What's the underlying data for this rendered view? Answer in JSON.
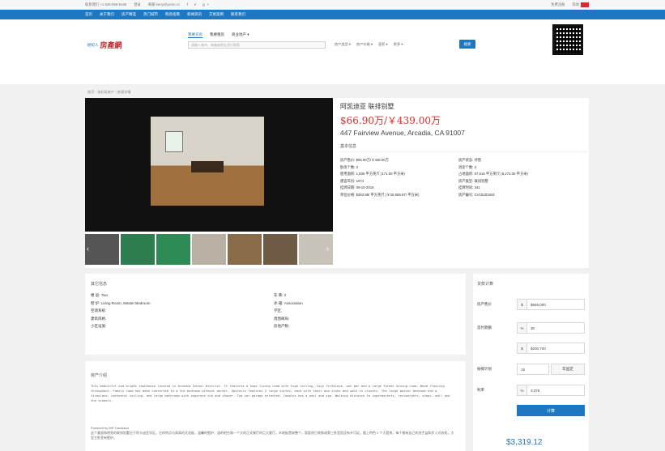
{
  "topbar": {
    "phone": "联系我们 +1 626-559-9168",
    "login": "登录",
    "email": "邮箱 kerry@yiviru.cc",
    "social": "f ✔ g+",
    "register": "免费注册",
    "lang": "简体"
  },
  "nav": [
    "首页",
    "关于我们",
    "房产精选",
    "热门城市",
    "购房指南",
    "新闻资讯",
    "交易案例",
    "联系我们"
  ],
  "logo": {
    "small": "經紀人",
    "mark": "房產網"
  },
  "search": {
    "tabs": [
      "我要买房",
      "我要租房",
      "商业地产 ▾"
    ],
    "placeholder": "请输入城市、邮编或地址进行搜索",
    "filters": [
      "房产类型 ▾",
      "房产价格 ▾",
      "面积 ▾",
      "更多 ▾"
    ],
    "button": "搜索"
  },
  "breadcrumb": "首页 › 洛杉矶房产 › 房源详情",
  "listing": {
    "title": "阿凯迪亚 联排别墅",
    "price": "$66.90万/￥439.00万",
    "address": "447 Fairview Avenue, Arcadia, CA 91007",
    "basic_title": "基本信息",
    "details": [
      "房产售价: $66.90万/￥439.00万",
      "房产状态: 待售",
      "卧房个数: 3",
      "浴室个数: 3",
      "使用面积: 1,838 平方英尺 (171.00 平方米)",
      "占地面积: 67,515 平方英尺 (6,272.00 平方米)",
      "建造年份: 1974",
      "房产类型: 联排别墅",
      "挂牌日期: 09-10-2015",
      "挂牌时间: 341",
      "单位价格: $363.98/ 平方英尺 (￥25,659.87/ 平方米)",
      "房产编号: CV15201844"
    ]
  },
  "other": {
    "title": "其它信息",
    "left": [
      "楼 层: Two",
      "壁 炉: Living Room, Master Bedroom",
      "空调系统:",
      "建筑风格:",
      "小区设施:"
    ],
    "right": [
      "车 库: 2",
      "冰 箱: Association",
      "学区:",
      "周围邮局:",
      "房地产税:"
    ]
  },
  "intro": {
    "title": "房产介绍",
    "text": "This beautiful and bright townhouse located in Arcadia School District. It features a huge living room with high ceiling, Cozy fireplace, wet bar and a large formal dining room. Wood flooring throughout. Family room has been converted to a 3rd bedroom without permit. Upstairs features 2 large suites, each with their own sinks and walk in closets. The large master bedroom has a fireplace, cathedral ceiling, and large bathroom with separate tub and shower. Two car garage attached. Complex has a pool and spa. Walking distance to supermarkets, restaurants, shops, mall and the schools.",
    "translated_note": "Powered by MS Translator",
    "chinese": "这个美丽和明亮的联排别墅位于阿卡迪亚学区。它的特点与高高的天花板，温馨的壁炉，湿的吧台和一个大的正式餐厅的巨大客厅。木地板贯穿整个。家庭房已转换成第三卧室而没有许可证。楼上特色 2 个大套房，每个都有自己的洗手盆和步入式衣柜。大型主卧室有壁炉。"
  },
  "calc": {
    "title": "贷款计算",
    "labels": [
      "房产售价",
      "首付款额",
      "按揭计划",
      "利率"
    ],
    "price": "$669,000",
    "down_pct": "30",
    "down_amt": "$200,700",
    "years": "15",
    "years_unit": "年固定",
    "rate": "3.375",
    "button": "计算",
    "result": "$3,319.12"
  },
  "colors": {
    "brand_blue": "#1d78c1",
    "price_red": "#d9302a"
  }
}
